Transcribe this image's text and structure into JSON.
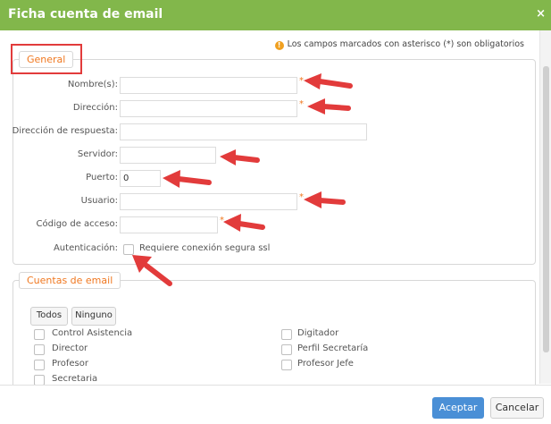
{
  "dialog": {
    "title": "Ficha cuenta de email",
    "close_glyph": "×",
    "required_note": "Los campos marcados con asterisco (*) son obligatorios",
    "info_icon": "!"
  },
  "general": {
    "legend": "General",
    "fields": {
      "nombres": {
        "label": "Nombre(s):",
        "value": "",
        "required": "*"
      },
      "direccion": {
        "label": "Dirección:",
        "value": "",
        "required": "*"
      },
      "respuesta": {
        "label": "Dirección de respuesta:",
        "value": ""
      },
      "servidor": {
        "label": "Servidor:",
        "value": ""
      },
      "puerto": {
        "label": "Puerto:",
        "value": "0"
      },
      "usuario": {
        "label": "Usuario:",
        "value": "",
        "required": "*"
      },
      "codigo": {
        "label": "Código de acceso:",
        "value": "",
        "required": "*"
      },
      "autenticacion": {
        "label": "Autenticación:",
        "checkbox_label": "Requiere conexión segura ssl"
      }
    }
  },
  "cuentas": {
    "legend": "Cuentas de email",
    "todos": "Todos",
    "ninguno": "Ninguno",
    "left": [
      "Control Asistencia",
      "Director",
      "Profesor",
      "Secretaria"
    ],
    "right": [
      "Digitador",
      "Perfil Secretaría",
      "Profesor Jefe"
    ]
  },
  "footer": {
    "accept": "Aceptar",
    "cancel": "Cancelar"
  },
  "colors": {
    "titlebar": "#82b74b",
    "accent": "#f07820",
    "annotation": "#e23b3b",
    "primary_button": "#4a8fd6"
  }
}
